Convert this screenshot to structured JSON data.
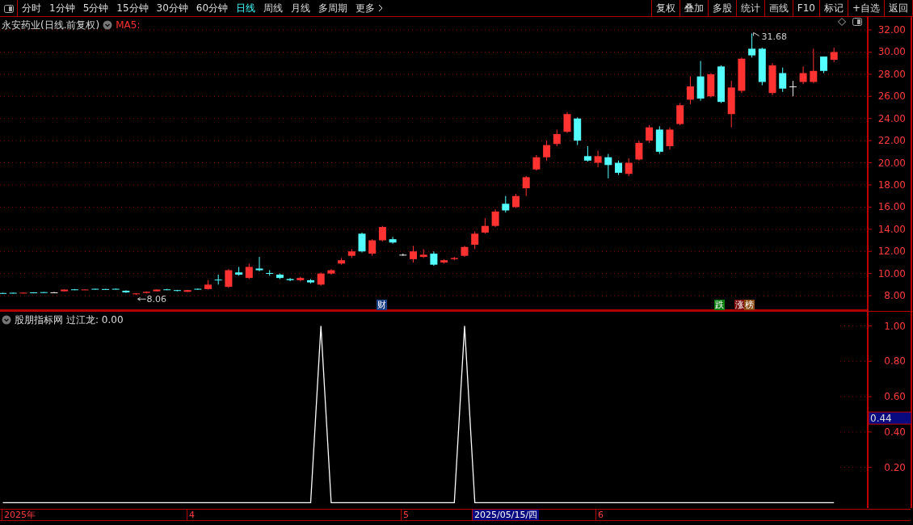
{
  "toolbar": {
    "periods": [
      {
        "label": "分时",
        "selected": false
      },
      {
        "label": "1分钟",
        "selected": false
      },
      {
        "label": "5分钟",
        "selected": false
      },
      {
        "label": "15分钟",
        "selected": false
      },
      {
        "label": "30分钟",
        "selected": false
      },
      {
        "label": "60分钟",
        "selected": false
      },
      {
        "label": "日线",
        "selected": true
      },
      {
        "label": "周线",
        "selected": false
      },
      {
        "label": "月线",
        "selected": false
      },
      {
        "label": "多周期",
        "selected": false
      }
    ],
    "more_menu": {
      "label": "更多"
    },
    "actions": [
      "复权",
      "叠加",
      "多股",
      "统计",
      "画线",
      "F10",
      "标记",
      "+自选",
      "返回"
    ]
  },
  "price_chart": {
    "title": "永安药业(日线.前复权)",
    "indicator_label": "MA5:",
    "high_label": "31.68",
    "low_label": "8.06",
    "event_tags": [
      {
        "text": "财",
        "color": "#1c3f86"
      },
      {
        "text": "跌",
        "color": "#0b7d10"
      },
      {
        "text": "涨",
        "color": "#7a0c0c"
      },
      {
        "text": "榜",
        "color": "#8a4a12"
      }
    ],
    "chart_data": {
      "type": "candlestick",
      "grid": true,
      "ylim": [
        6.62,
        33.17
      ],
      "yticks": [
        {
          "value": 32,
          "label": "32.00"
        },
        {
          "value": 30,
          "label": "30.00"
        },
        {
          "value": 28,
          "label": "28.00"
        },
        {
          "value": 26,
          "label": "26.00"
        },
        {
          "value": 24,
          "label": "24.00"
        },
        {
          "value": 22,
          "label": "22.00"
        },
        {
          "value": 20,
          "label": "20.00"
        },
        {
          "value": 18,
          "label": "18.00"
        },
        {
          "value": 16,
          "label": "16.00"
        },
        {
          "value": 14,
          "label": "14.00"
        },
        {
          "value": 12,
          "label": "12.00"
        },
        {
          "value": 10,
          "label": "10.00"
        },
        {
          "value": 8,
          "label": "8.00"
        }
      ],
      "categories": [
        null,
        null,
        null,
        null,
        null,
        null,
        null,
        null,
        null,
        null,
        null,
        null,
        null,
        null,
        null,
        null,
        null,
        null,
        null,
        null,
        null,
        null,
        null,
        null,
        null,
        null,
        null,
        null,
        null,
        null,
        null,
        null,
        null,
        null,
        null,
        null,
        null,
        null,
        null,
        null,
        null,
        null,
        null,
        null,
        null,
        null,
        null,
        null,
        null,
        null,
        null,
        null,
        null,
        null,
        null,
        null,
        null,
        null,
        null,
        null,
        null,
        null,
        null,
        null,
        null,
        null,
        null,
        null,
        null,
        null,
        null,
        null,
        null,
        null,
        null,
        null,
        null,
        null,
        null,
        null,
        null,
        null
      ],
      "ohlc": [
        [
          8.24,
          8.26,
          8.2,
          8.22
        ],
        [
          8.26,
          8.28,
          8.2,
          8.24
        ],
        [
          8.2,
          8.3,
          8.2,
          8.27
        ],
        [
          8.3,
          8.31,
          8.25,
          8.28
        ],
        [
          8.32,
          8.33,
          8.28,
          8.3
        ],
        [
          8.3,
          8.34,
          8.28,
          8.3
        ],
        [
          8.4,
          8.58,
          8.38,
          8.55
        ],
        [
          8.57,
          8.6,
          8.5,
          8.55
        ],
        [
          8.54,
          8.57,
          8.53,
          8.56
        ],
        [
          8.62,
          8.63,
          8.55,
          8.6
        ],
        [
          8.6,
          8.61,
          8.55,
          8.58
        ],
        [
          8.62,
          8.64,
          8.55,
          8.6
        ],
        [
          8.45,
          8.48,
          8.25,
          8.3
        ],
        [
          8.16,
          8.22,
          8.06,
          8.2
        ],
        [
          8.25,
          8.38,
          8.2,
          8.35
        ],
        [
          8.4,
          8.58,
          8.38,
          8.55
        ],
        [
          8.57,
          8.62,
          8.5,
          8.55
        ],
        [
          8.5,
          8.52,
          8.4,
          8.45
        ],
        [
          8.35,
          8.52,
          8.33,
          8.5
        ],
        [
          8.62,
          8.65,
          8.55,
          8.6
        ],
        [
          8.6,
          9.4,
          8.55,
          9.0
        ],
        [
          9.45,
          9.9,
          9.0,
          9.4
        ],
        [
          8.8,
          10.4,
          8.7,
          10.3
        ],
        [
          10.1,
          10.6,
          9.8,
          9.9
        ],
        [
          9.6,
          10.9,
          9.5,
          10.6
        ],
        [
          10.45,
          11.5,
          10.2,
          10.3
        ],
        [
          10.05,
          10.3,
          9.8,
          10.0
        ],
        [
          9.9,
          10.0,
          9.5,
          9.6
        ],
        [
          9.5,
          9.6,
          9.3,
          9.4
        ],
        [
          9.4,
          9.7,
          9.3,
          9.6
        ],
        [
          9.4,
          9.5,
          9.1,
          9.2
        ],
        [
          9.0,
          10.1,
          8.9,
          10.0
        ],
        [
          10.0,
          10.4,
          9.9,
          10.3
        ],
        [
          10.9,
          11.4,
          10.8,
          11.2
        ],
        [
          11.6,
          12.2,
          11.4,
          12.0
        ],
        [
          13.6,
          13.7,
          11.9,
          12.0
        ],
        [
          11.8,
          13.1,
          11.6,
          13.0
        ],
        [
          13.0,
          14.3,
          12.9,
          14.2
        ],
        [
          13.1,
          13.3,
          12.7,
          12.8
        ],
        [
          11.7,
          11.8,
          11.6,
          11.7
        ],
        [
          11.3,
          12.5,
          11.0,
          12.0
        ],
        [
          11.5,
          12.2,
          11.4,
          11.7
        ],
        [
          11.8,
          12.0,
          10.7,
          10.8
        ],
        [
          11.0,
          11.3,
          10.9,
          11.2
        ],
        [
          11.3,
          11.5,
          11.2,
          11.4
        ],
        [
          11.6,
          12.5,
          11.5,
          12.4
        ],
        [
          12.6,
          13.8,
          12.2,
          13.6
        ],
        [
          13.7,
          15.0,
          13.6,
          14.3
        ],
        [
          14.3,
          15.8,
          14.2,
          15.6
        ],
        [
          16.3,
          17.0,
          15.5,
          15.7
        ],
        [
          16.0,
          17.2,
          15.9,
          17.0
        ],
        [
          17.7,
          18.8,
          17.0,
          18.7
        ],
        [
          19.4,
          20.7,
          19.3,
          20.5
        ],
        [
          20.5,
          22.0,
          20.2,
          21.6
        ],
        [
          21.7,
          23.0,
          21.5,
          22.6
        ],
        [
          22.8,
          24.6,
          22.7,
          24.4
        ],
        [
          24.0,
          24.1,
          21.6,
          22.0
        ],
        [
          20.6,
          21.5,
          20.1,
          20.2
        ],
        [
          20.0,
          21.1,
          19.6,
          20.6
        ],
        [
          20.5,
          20.8,
          18.6,
          19.8
        ],
        [
          20.0,
          20.2,
          18.9,
          19.1
        ],
        [
          19.0,
          20.4,
          18.8,
          20.0
        ],
        [
          20.3,
          22.0,
          20.2,
          21.8
        ],
        [
          22.0,
          23.4,
          21.8,
          23.2
        ],
        [
          23.0,
          23.3,
          20.8,
          21.0
        ],
        [
          21.5,
          23.2,
          21.2,
          23.0
        ],
        [
          23.5,
          25.4,
          23.4,
          25.2
        ],
        [
          25.7,
          27.8,
          25.3,
          26.9
        ],
        [
          27.8,
          29.2,
          25.6,
          25.8
        ],
        [
          26.0,
          28.1,
          25.9,
          28.0
        ],
        [
          28.7,
          28.8,
          25.4,
          25.5
        ],
        [
          24.4,
          27.4,
          23.2,
          26.8
        ],
        [
          26.5,
          29.5,
          26.3,
          29.4
        ],
        [
          30.3,
          31.68,
          29.5,
          29.7
        ],
        [
          30.3,
          30.4,
          27.0,
          27.3
        ],
        [
          26.3,
          29.0,
          26.1,
          28.8
        ],
        [
          28.1,
          28.6,
          26.4,
          26.7
        ],
        [
          26.9,
          27.4,
          26.0,
          26.9
        ],
        [
          27.3,
          28.7,
          27.1,
          28.1
        ],
        [
          27.3,
          30.3,
          27.2,
          28.3
        ],
        [
          29.6,
          29.6,
          28.1,
          28.3
        ],
        [
          29.3,
          30.4,
          29.1,
          30.0
        ]
      ]
    }
  },
  "indicator": {
    "source": "股朋指标网",
    "value": ": 0.00",
    "current_value": "0.44",
    "chart_data": {
      "type": "line",
      "categories": [
        null,
        null,
        null,
        null,
        null,
        null,
        null,
        null,
        null,
        null,
        null,
        null,
        null,
        null,
        null,
        null,
        null,
        null,
        null,
        null,
        null,
        null,
        null,
        null,
        null,
        null,
        null,
        null,
        null,
        null,
        null,
        null,
        null,
        null,
        null,
        null,
        null,
        null,
        null,
        null,
        null,
        null,
        null,
        null,
        null,
        null,
        null,
        null,
        null,
        null,
        null,
        null,
        null,
        null,
        null,
        null,
        null,
        null,
        null,
        null,
        null,
        null,
        null,
        null,
        null,
        null,
        null,
        null,
        null,
        null,
        null,
        null,
        null,
        null,
        null,
        null,
        null,
        null,
        null,
        null,
        null,
        null
      ],
      "ylim": [
        -0.03,
        1.08
      ],
      "yticks": [
        {
          "value": 1,
          "label": "1.00"
        },
        {
          "value": 0.8,
          "label": "0.80"
        },
        {
          "value": 0.6,
          "label": "0.60"
        },
        {
          "value": 0.4,
          "label": "0.40"
        },
        {
          "value": 0.2,
          "label": "0.20"
        }
      ],
      "series": [
        {
          "name": "过江龙",
          "color": "#ffffff",
          "values": [
            0,
            0,
            0,
            0,
            0,
            0,
            0,
            0,
            0,
            0,
            0,
            0,
            0,
            0,
            0,
            0,
            0,
            0,
            0,
            0,
            0,
            0,
            0,
            0,
            0,
            0,
            0,
            0,
            0,
            0,
            0,
            1,
            0,
            0,
            0,
            0,
            0,
            0,
            0,
            0,
            0,
            0,
            0,
            0,
            0,
            1,
            0,
            0,
            0,
            0,
            0,
            0,
            0,
            0,
            0,
            0,
            0,
            0,
            0,
            0,
            0,
            0,
            0,
            0,
            0,
            0,
            0,
            0,
            0,
            0,
            0,
            0,
            0,
            0,
            0,
            0,
            0,
            0,
            0,
            0,
            0,
            0
          ]
        }
      ]
    }
  },
  "date_axis": [
    {
      "label": "2025年",
      "selected": false
    },
    {
      "label": "4",
      "selected": false
    },
    {
      "label": "5",
      "selected": false
    },
    {
      "label": "2025/05/15/四",
      "selected": true
    },
    {
      "label": "6",
      "selected": false
    }
  ]
}
